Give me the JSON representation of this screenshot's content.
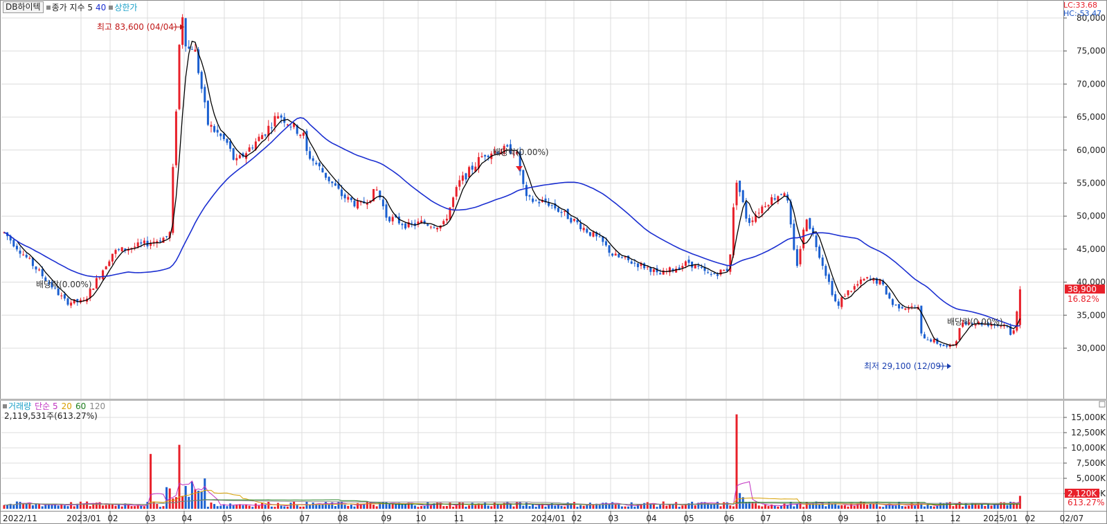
{
  "price_header": {
    "stock_name": "DB하이텍",
    "indicator": "종가 지수 5",
    "ma_period": "40",
    "limit_label": "상한가"
  },
  "corner_labels": {
    "lc": "LC:33.68",
    "hc": "HC:-53.47"
  },
  "price_axis_ticks": [
    "80,000",
    "75,000",
    "70,000",
    "65,000",
    "60,000",
    "55,000",
    "50,000",
    "45,000",
    "40,000",
    "35,000",
    "30,000"
  ],
  "current_price_badge": {
    "price": "38,900",
    "change": "16.82%"
  },
  "annotations": {
    "high": "최고 83,600 (04/04)",
    "low": "최저 29,100 (12/09)",
    "dividend_1": "배당락(0.00%)",
    "dividend_2": "배당락(0.00%)",
    "dividend_3": "배당락(0.00%)"
  },
  "volume_header": {
    "title": "거래량",
    "ma_label": "단순 5",
    "ma20": "20",
    "ma60": "60",
    "ma120": "120",
    "current_volume": "2,119,531주(613.27%)"
  },
  "volume_axis_ticks": [
    "15,000K",
    "12,500K",
    "10,000K",
    "7,500K",
    "5,000K",
    "2,500K"
  ],
  "volume_badge": {
    "volume": "2,120K",
    "ratio": "613.27%"
  },
  "x_axis_labels": [
    "2022/11",
    "2023/01",
    "02",
    "03",
    "04",
    "05",
    "06",
    "07",
    "08",
    "09",
    "10",
    "11",
    "12",
    "2024/01",
    "02",
    "03",
    "04",
    "05",
    "06",
    "07",
    "08",
    "09",
    "10",
    "11",
    "12",
    "2025/01",
    "02",
    "02/07"
  ],
  "colors": {
    "up": "#e8202a",
    "down": "#1a5fd0",
    "ma_short": "#000000",
    "ma_long": "#1b2fd1",
    "grid": "#dcdcdc",
    "volume_ma5": "#c030c0",
    "volume_ma20": "#d8a000",
    "volume_ma60": "#208020",
    "volume_ma120": "#888888"
  },
  "chart_data": [
    {
      "type": "candlestick",
      "title": "",
      "series": [
        {
          "name": "DB하이텍",
          "x": [
            "2022/11",
            "2023/01",
            "02",
            "03",
            "04",
            "05",
            "06",
            "07",
            "08",
            "09",
            "10",
            "11",
            "12",
            "2024/01",
            "02",
            "03",
            "04",
            "05",
            "06",
            "07",
            "08",
            "09",
            "10",
            "11",
            "12",
            "2025/01",
            "02",
            "02/07"
          ],
          "close_approx": [
            47500,
            37000,
            44500,
            46000,
            75000,
            61000,
            63000,
            62000,
            53000,
            50000,
            49000,
            55000,
            60000,
            52000,
            49000,
            44000,
            42000,
            43000,
            42000,
            52000,
            50000,
            38000,
            40000,
            36000,
            31000,
            33500,
            32000,
            38900
          ],
          "high": 83600,
          "high_date": "04/04",
          "low": 29100,
          "low_date": "12/09",
          "last": 38900,
          "change_pct": 16.82
        },
        {
          "name": "40",
          "values_approx": [
            42500,
            39000,
            42000,
            45500,
            62000,
            61500,
            62000,
            62000,
            57000,
            52000,
            51000,
            52500,
            57500,
            53000,
            50000,
            47000,
            44500,
            42500,
            42500,
            47500,
            50000,
            43000,
            41000,
            37500,
            34000,
            34000,
            34000,
            34000
          ]
        }
      ],
      "ylim": [
        27000,
        86000
      ],
      "yticks": [
        30000,
        35000,
        40000,
        45000,
        50000,
        55000,
        60000,
        65000,
        70000,
        75000,
        80000
      ]
    },
    {
      "type": "bar",
      "title": "",
      "series": [
        {
          "name": "거래량",
          "spikes": [
            {
              "month": "03",
              "value": 9000
            },
            {
              "month": "04",
              "value": 10500
            },
            {
              "month": "07",
              "value": 15500
            },
            {
              "month": "02/07",
              "value": 2120
            }
          ],
          "last": 2119531,
          "ratio_pct": 613.27
        }
      ],
      "ylim": [
        0,
        17000
      ],
      "yticks": [
        2500,
        5000,
        7500,
        10000,
        12500,
        15000
      ]
    }
  ]
}
